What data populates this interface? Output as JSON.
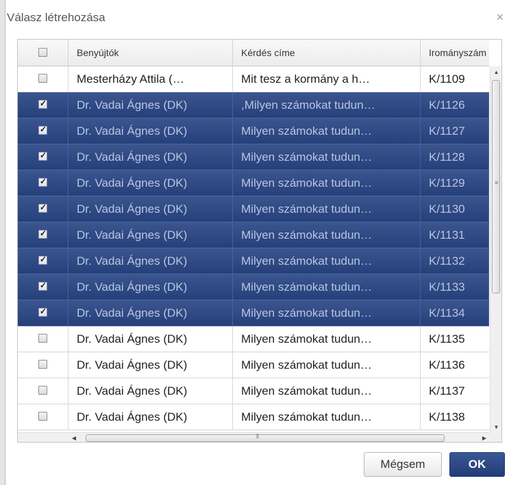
{
  "dialog": {
    "title": "Válasz létrehozása",
    "close_glyph": "×"
  },
  "table": {
    "columns": [
      "",
      "Benyújtók",
      "Kérdés címe",
      "Irományszám"
    ],
    "rows": [
      {
        "checked": false,
        "submitter": "Mesterházy Attila (…",
        "question": "Mit tesz a kormány a h…",
        "id": "K/1109"
      },
      {
        "checked": true,
        "submitter": "Dr. Vadai Ágnes (DK)",
        "question": ",Milyen számokat tudun…",
        "id": "K/1126"
      },
      {
        "checked": true,
        "submitter": "Dr. Vadai Ágnes (DK)",
        "question": "Milyen számokat tudun…",
        "id": "K/1127"
      },
      {
        "checked": true,
        "submitter": "Dr. Vadai Ágnes (DK)",
        "question": "Milyen számokat tudun…",
        "id": "K/1128"
      },
      {
        "checked": true,
        "submitter": "Dr. Vadai Ágnes (DK)",
        "question": "Milyen számokat tudun…",
        "id": "K/1129"
      },
      {
        "checked": true,
        "submitter": "Dr. Vadai Ágnes (DK)",
        "question": "Milyen számokat tudun…",
        "id": "K/1130"
      },
      {
        "checked": true,
        "submitter": "Dr. Vadai Ágnes (DK)",
        "question": "Milyen számokat tudun…",
        "id": "K/1131"
      },
      {
        "checked": true,
        "submitter": "Dr. Vadai Ágnes (DK)",
        "question": "Milyen számokat tudun…",
        "id": "K/1132"
      },
      {
        "checked": true,
        "submitter": "Dr. Vadai Ágnes (DK)",
        "question": "Milyen számokat tudun…",
        "id": "K/1133"
      },
      {
        "checked": true,
        "submitter": "Dr. Vadai Ágnes (DK)",
        "question": "Milyen számokat tudun…",
        "id": "K/1134"
      },
      {
        "checked": false,
        "submitter": "Dr. Vadai Ágnes (DK)",
        "question": "Milyen számokat tudun…",
        "id": "K/1135"
      },
      {
        "checked": false,
        "submitter": "Dr. Vadai Ágnes (DK)",
        "question": "Milyen számokat tudun…",
        "id": "K/1136"
      },
      {
        "checked": false,
        "submitter": "Dr. Vadai Ágnes (DK)",
        "question": "Milyen számokat tudun…",
        "id": "K/1137"
      },
      {
        "checked": false,
        "submitter": "Dr. Vadai Ágnes (DK)",
        "question": "Milyen számokat tudun…",
        "id": "K/1138"
      }
    ]
  },
  "buttons": {
    "cancel": "Mégsem",
    "ok": "OK"
  },
  "colors": {
    "selected_row": "#2d4884",
    "ok_button": "#2d4884"
  },
  "icons": {
    "scroll_up": "triangle-up-icon",
    "scroll_down": "triangle-down-icon",
    "scroll_left": "triangle-left-icon",
    "scroll_right": "triangle-right-icon",
    "close": "close-icon"
  }
}
